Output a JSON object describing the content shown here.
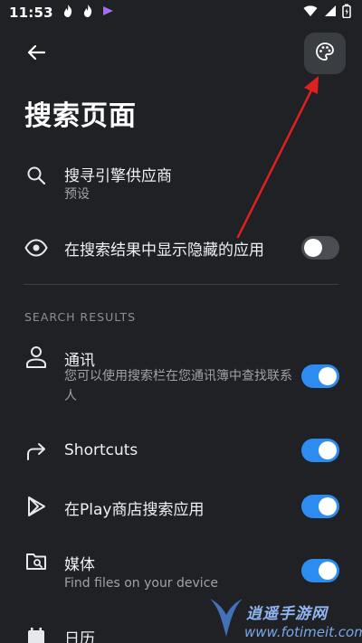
{
  "status_bar": {
    "time": "11:53",
    "left_icons": [
      "fire-icon",
      "fire-icon",
      "app-icon"
    ],
    "right_icons": [
      "wifi-icon",
      "signal-icon",
      "battery-icon"
    ]
  },
  "header": {
    "title": "搜索页面"
  },
  "settings": [
    {
      "icon": "search-icon",
      "title": "搜寻引擎供应商",
      "subtitle": "预设"
    },
    {
      "icon": "eye-icon",
      "title": "在搜索结果中显示隐藏的应用",
      "toggle": false
    }
  ],
  "search_results": {
    "header": "SEARCH RESULTS",
    "items": [
      {
        "icon": "person-icon",
        "title": "通讯",
        "subtitle": "您可以使用搜索栏在您通讯簿中查找联系人",
        "toggle": true
      },
      {
        "icon": "share-arrow-icon",
        "title": "Shortcuts",
        "toggle": true
      },
      {
        "icon": "play-icon",
        "title": "在Play商店搜索应用",
        "toggle": true
      },
      {
        "icon": "folder-search-icon",
        "title": "媒体",
        "subtitle": "Find files on your device",
        "toggle": true
      },
      {
        "icon": "calendar-icon",
        "title": "日历"
      }
    ]
  },
  "colors": {
    "background": "#1f2125",
    "accent": "#2d8cf0",
    "annotation_arrow": "#e02020"
  },
  "watermark": {
    "site": "www.fotimeit.com",
    "brand": "逍遥手游网"
  }
}
